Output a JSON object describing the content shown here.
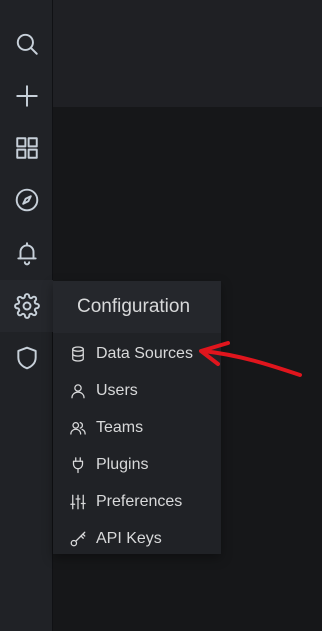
{
  "sidebar": {
    "items": [
      {
        "icon": "search-icon"
      },
      {
        "icon": "plus-icon"
      },
      {
        "icon": "dashboards-grid-icon"
      },
      {
        "icon": "compass-icon"
      },
      {
        "icon": "bell-icon"
      },
      {
        "icon": "gear-icon",
        "active": true
      },
      {
        "icon": "shield-icon"
      }
    ]
  },
  "config_menu": {
    "title": "Configuration",
    "items": [
      {
        "label": "Data Sources",
        "icon": "database-icon"
      },
      {
        "label": "Users",
        "icon": "user-icon"
      },
      {
        "label": "Teams",
        "icon": "users-icon"
      },
      {
        "label": "Plugins",
        "icon": "plug-icon"
      },
      {
        "label": "Preferences",
        "icon": "sliders-icon"
      },
      {
        "label": "API Keys",
        "icon": "key-icon"
      }
    ]
  },
  "annotation": {
    "arrow_color": "#e0151d"
  },
  "colors": {
    "background": "#161719",
    "sidebar": "#202226",
    "menu_header": "#25272c",
    "text": "#d8d9da"
  }
}
